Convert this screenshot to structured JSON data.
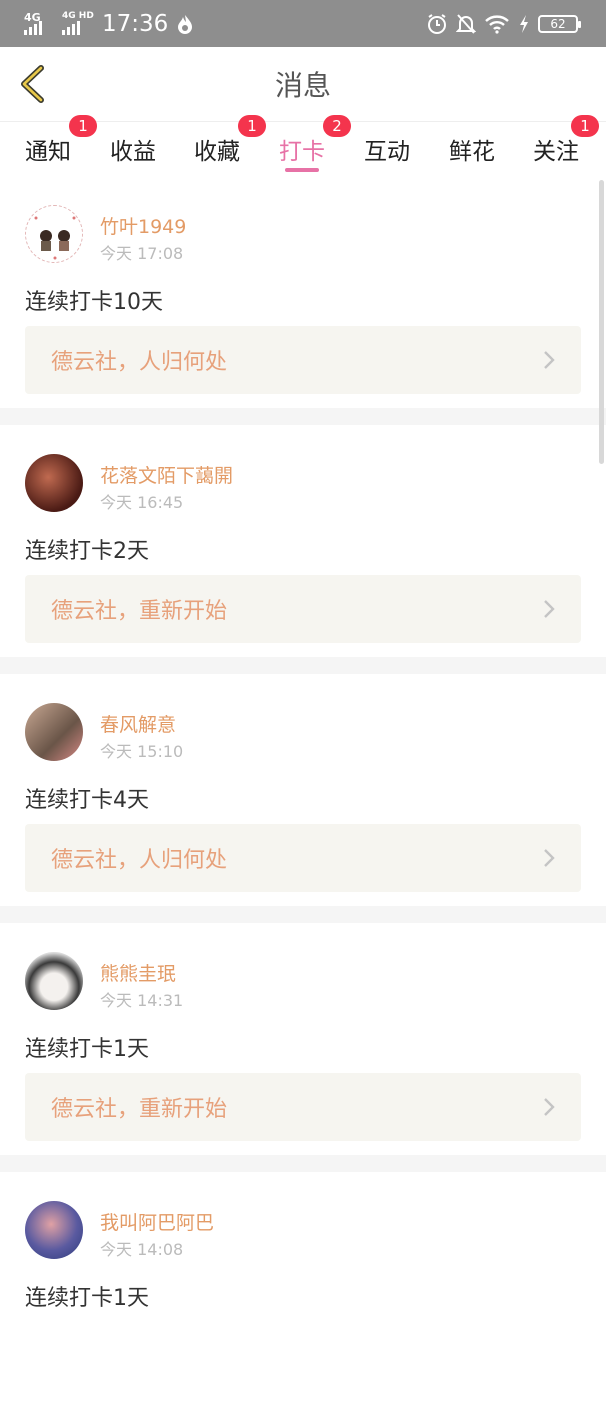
{
  "status_bar": {
    "signal_1": "4G",
    "signal_2": "4G HD",
    "time": "17:36",
    "battery": "62",
    "icons": [
      "alarm-icon",
      "bell-off-icon",
      "wifi-icon",
      "charging-icon"
    ]
  },
  "header": {
    "title": "消息",
    "back_icon": "back-chevron-icon"
  },
  "tabs": [
    {
      "label": "通知",
      "badge": "1"
    },
    {
      "label": "收益",
      "badge": ""
    },
    {
      "label": "收藏",
      "badge": "1"
    },
    {
      "label": "打卡",
      "badge": "2",
      "active": true
    },
    {
      "label": "互动",
      "badge": ""
    },
    {
      "label": "鲜花",
      "badge": ""
    },
    {
      "label": "关注",
      "badge": "1"
    }
  ],
  "posts": [
    {
      "user": "竹叶1949",
      "time": "今天 17:08",
      "text": "连续打卡10天",
      "topic": "德云社，人归何处"
    },
    {
      "user": "花落文陌下藹開",
      "time": "今天 16:45",
      "text": "连续打卡2天",
      "topic": "德云社，重新开始"
    },
    {
      "user": "春风解意",
      "time": "今天 15:10",
      "text": "连续打卡4天",
      "topic": "德云社，人归何处"
    },
    {
      "user": "熊熊圭珉",
      "time": "今天 14:31",
      "text": "连续打卡1天",
      "topic": "德云社，重新开始"
    },
    {
      "user": "我叫阿巴阿巴",
      "time": "今天 14:08",
      "text": "连续打卡1天",
      "topic": ""
    }
  ],
  "colors": {
    "accent": "#e772a6",
    "badge": "#f4344d",
    "username": "#e39b66",
    "topic_text": "#e7a17b",
    "topic_bg": "#f6f5f0"
  }
}
